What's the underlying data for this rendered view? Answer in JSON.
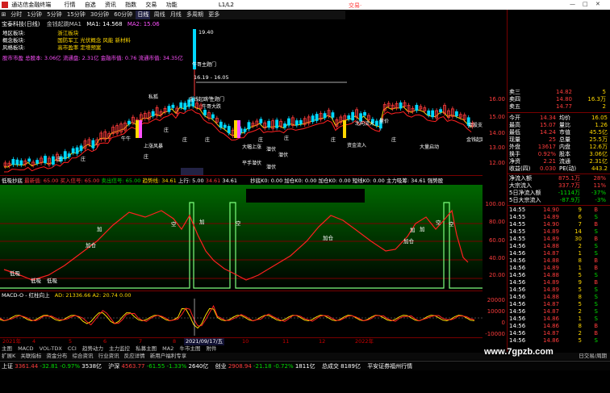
{
  "titlebar": {
    "app_name": "通达信金融终端",
    "menus": [
      "行情",
      "自选",
      "资讯",
      "指数",
      "交易",
      "功能"
    ],
    "version": "L1/L2",
    "trade_label": "交易·",
    "win_controls": [
      "—",
      "□",
      "✕"
    ]
  },
  "periods": [
    "分时",
    "1分钟",
    "5分钟",
    "15分钟",
    "30分钟",
    "60分钟",
    "日线",
    "周线",
    "月线",
    "多周期",
    "更多"
  ],
  "info_box": {
    "stock_line": "宝泰科技(日线)",
    "region_label": "地区板块:",
    "region_value": "浙江板块",
    "concept_label": "概念板块:",
    "concept_value": "国防军工 光伏概念 风能 新材料",
    "style_label": "风格板块:",
    "style_value": "高市盈率 定增预案",
    "stats_line": "股市市盈  总股本: 3.06亿 流通盘: 2.31亿 金融市值: 0.76 流通市值: 34.35亿"
  },
  "main_header": {
    "title": "金钱起跳MA1",
    "ma1": "MA1: 14.568",
    "ma2": "MA2: 15.06"
  },
  "main_chart": {
    "price_ticks": [
      "16.00",
      "15.00",
      "14.00",
      "13.00",
      "12.00"
    ],
    "high_label": "19.40",
    "range_label": "16.19 - 16.05",
    "signals": [
      "牛哥主题门",
      "金钱起跳牛",
      "主题门",
      "私狐",
      "上涨风暴",
      "庄",
      "庄",
      "庄",
      "庄",
      "庄",
      "庄",
      "庄",
      "庄",
      "金钱起跳牛",
      "牛哥大跌",
      "大幅上涨",
      "牛牛",
      "资金流入",
      "大量启动",
      "庄",
      "北向流入",
      "量价",
      "潜伏",
      "潜伏",
      "庄",
      "平手潜伏",
      "潜伏",
      "金股支撑"
    ]
  },
  "indicator1": {
    "header": "低吸抄底",
    "params": [
      "最新值: 65.00",
      "买入信号: 65.00",
      "卖出信号: 65.00",
      "趋势线: 34.61",
      "上行: 5.00",
      "34.61",
      "34.61"
    ],
    "right_header": "抄底K0: 0.00  加仓K0: 0.00  加仓K0: 0.00  短线K0: 0.00  主力吸筹: 34.61  强势股",
    "ticks": [
      "100.00",
      "80.00",
      "60.00",
      "40.00",
      "20.00"
    ],
    "labels": [
      "低吸",
      "低吸",
      "低吸",
      "加",
      "加仓",
      "空",
      "加",
      "空",
      "加仓",
      "加仓",
      "加",
      "加",
      "空",
      "空"
    ]
  },
  "indicator2": {
    "header": "MACD-O - 红柱向上",
    "params": "AD: 21336.66  A2: 20.74  0.00",
    "ticks": [
      "20000",
      "10000",
      "0",
      "-10000"
    ]
  },
  "date_axis": {
    "labels": [
      "2021年",
      "4",
      "5",
      "6",
      "7",
      "8",
      "2021/09/17/五",
      "10",
      "11",
      "12",
      "2022年"
    ]
  },
  "bottom_tabs": [
    "主图",
    "MACD",
    "VOL-TDX",
    "CCI",
    "趋势动力",
    "主力监控",
    "私募主图",
    "MA2",
    "牛市主图",
    "附件"
  ],
  "bottom_tabs2": [
    "扩展K",
    "关联指标",
    "资金分布",
    "综合资讯",
    "行业资讯",
    "反应详情",
    "新用户福利专享"
  ],
  "bottom_right_label": "日交易/周期",
  "quote": {
    "sell_rows": [
      {
        "label": "卖三",
        "price": "14.82",
        "vol": "5"
      },
      {
        "label": "卖四",
        "price": "14.80",
        "vol": "16.3万"
      },
      {
        "label": "卖五",
        "price": "14.77",
        "vol": "2"
      }
    ],
    "stats": [
      {
        "l1": "今开",
        "v1": "14.34",
        "l2": "均价",
        "v2": "16.05"
      },
      {
        "l1": "最高",
        "v1": "15.07",
        "l2": "量比",
        "v2": "1.26"
      },
      {
        "l1": "最低",
        "v1": "14.24",
        "l2": "市值",
        "v2": "45.5亿"
      },
      {
        "l1": "现量",
        "v1": "25",
        "l2": "总量",
        "v2": "25.5万"
      },
      {
        "l1": "外盘",
        "v1": "13617",
        "l2": "内盘",
        "v2": "12.6万"
      },
      {
        "l1": "换手",
        "v1": "0.92%",
        "l2": "股本",
        "v2": "3.06亿"
      },
      {
        "l1": "净资",
        "v1": "2.21",
        "l2": "流通",
        "v2": "2.31亿"
      },
      {
        "l1": "收益(四)",
        "v1": "0.030",
        "l2": "PE(动)",
        "v2": "443.2"
      }
    ],
    "flows": [
      {
        "label": "净流入额",
        "value": "875.1万",
        "pct": "28%"
      },
      {
        "label": "大宗流入",
        "value": "337.7万",
        "pct": "11%"
      },
      {
        "label": "5日净流入额",
        "value": "-1114万",
        "pct": "-37%"
      },
      {
        "label": "5日大宗流入",
        "value": "-87.9万",
        "pct": "-3%"
      }
    ],
    "ticks": [
      {
        "t": "14:55",
        "p": "14.90",
        "v": "9",
        "d": "B"
      },
      {
        "t": "14:55",
        "p": "14.89",
        "v": "6",
        "d": "S"
      },
      {
        "t": "14:55",
        "p": "14.90",
        "v": "7",
        "d": "B"
      },
      {
        "t": "14:55",
        "p": "14.89",
        "v": "14",
        "d": "S"
      },
      {
        "t": "14:55",
        "p": "14.89",
        "v": "30",
        "d": "B"
      },
      {
        "t": "14:56",
        "p": "14.88",
        "v": "2",
        "d": "S"
      },
      {
        "t": "14:56",
        "p": "14.87",
        "v": "1",
        "d": "S"
      },
      {
        "t": "14:56",
        "p": "14.88",
        "v": "8",
        "d": "B"
      },
      {
        "t": "14:56",
        "p": "14.89",
        "v": "1",
        "d": "B"
      },
      {
        "t": "14:56",
        "p": "14.88",
        "v": "5",
        "d": "S"
      },
      {
        "t": "14:56",
        "p": "14.89",
        "v": "9",
        "d": "B"
      },
      {
        "t": "14:56",
        "p": "14.89",
        "v": "5",
        "d": "S"
      },
      {
        "t": "14:56",
        "p": "14.88",
        "v": "8",
        "d": "S"
      },
      {
        "t": "14:56",
        "p": "14.87",
        "v": "5",
        "d": "S"
      },
      {
        "t": "14:56",
        "p": "14.87",
        "v": "2",
        "d": "S"
      },
      {
        "t": "14:56",
        "p": "14.86",
        "v": "1",
        "d": "S"
      },
      {
        "t": "14:56",
        "p": "14.86",
        "v": "8",
        "d": "B"
      },
      {
        "t": "14:56",
        "p": "14.87",
        "v": "2",
        "d": "B"
      },
      {
        "t": "14:56",
        "p": "14.86",
        "v": "5",
        "d": "S"
      }
    ]
  },
  "status_bar": {
    "items": [
      {
        "name": "上证",
        "value": "3361.44",
        "change": "-32.81",
        "pct": "-0.97%",
        "vol": "3538亿"
      },
      {
        "name": "沪深",
        "value": "4563.77",
        "change": "-61.55",
        "pct": "-1.33%",
        "vol": "2640亿"
      },
      {
        "name": "创业",
        "value": "2908.94",
        "change": "-21.18",
        "pct": "-0.72%",
        "vol": "1811亿"
      }
    ],
    "total_label": "总成交",
    "total_value": "8189亿",
    "broker": "平安证券福州行情"
  },
  "watermark": "www.7gpzb.com",
  "colors": {
    "up": "#ff3c3c",
    "down": "#00d8ff",
    "ma": "#ffd800",
    "indicator_green": "#00b000",
    "indicator_line": "#ff2020"
  }
}
